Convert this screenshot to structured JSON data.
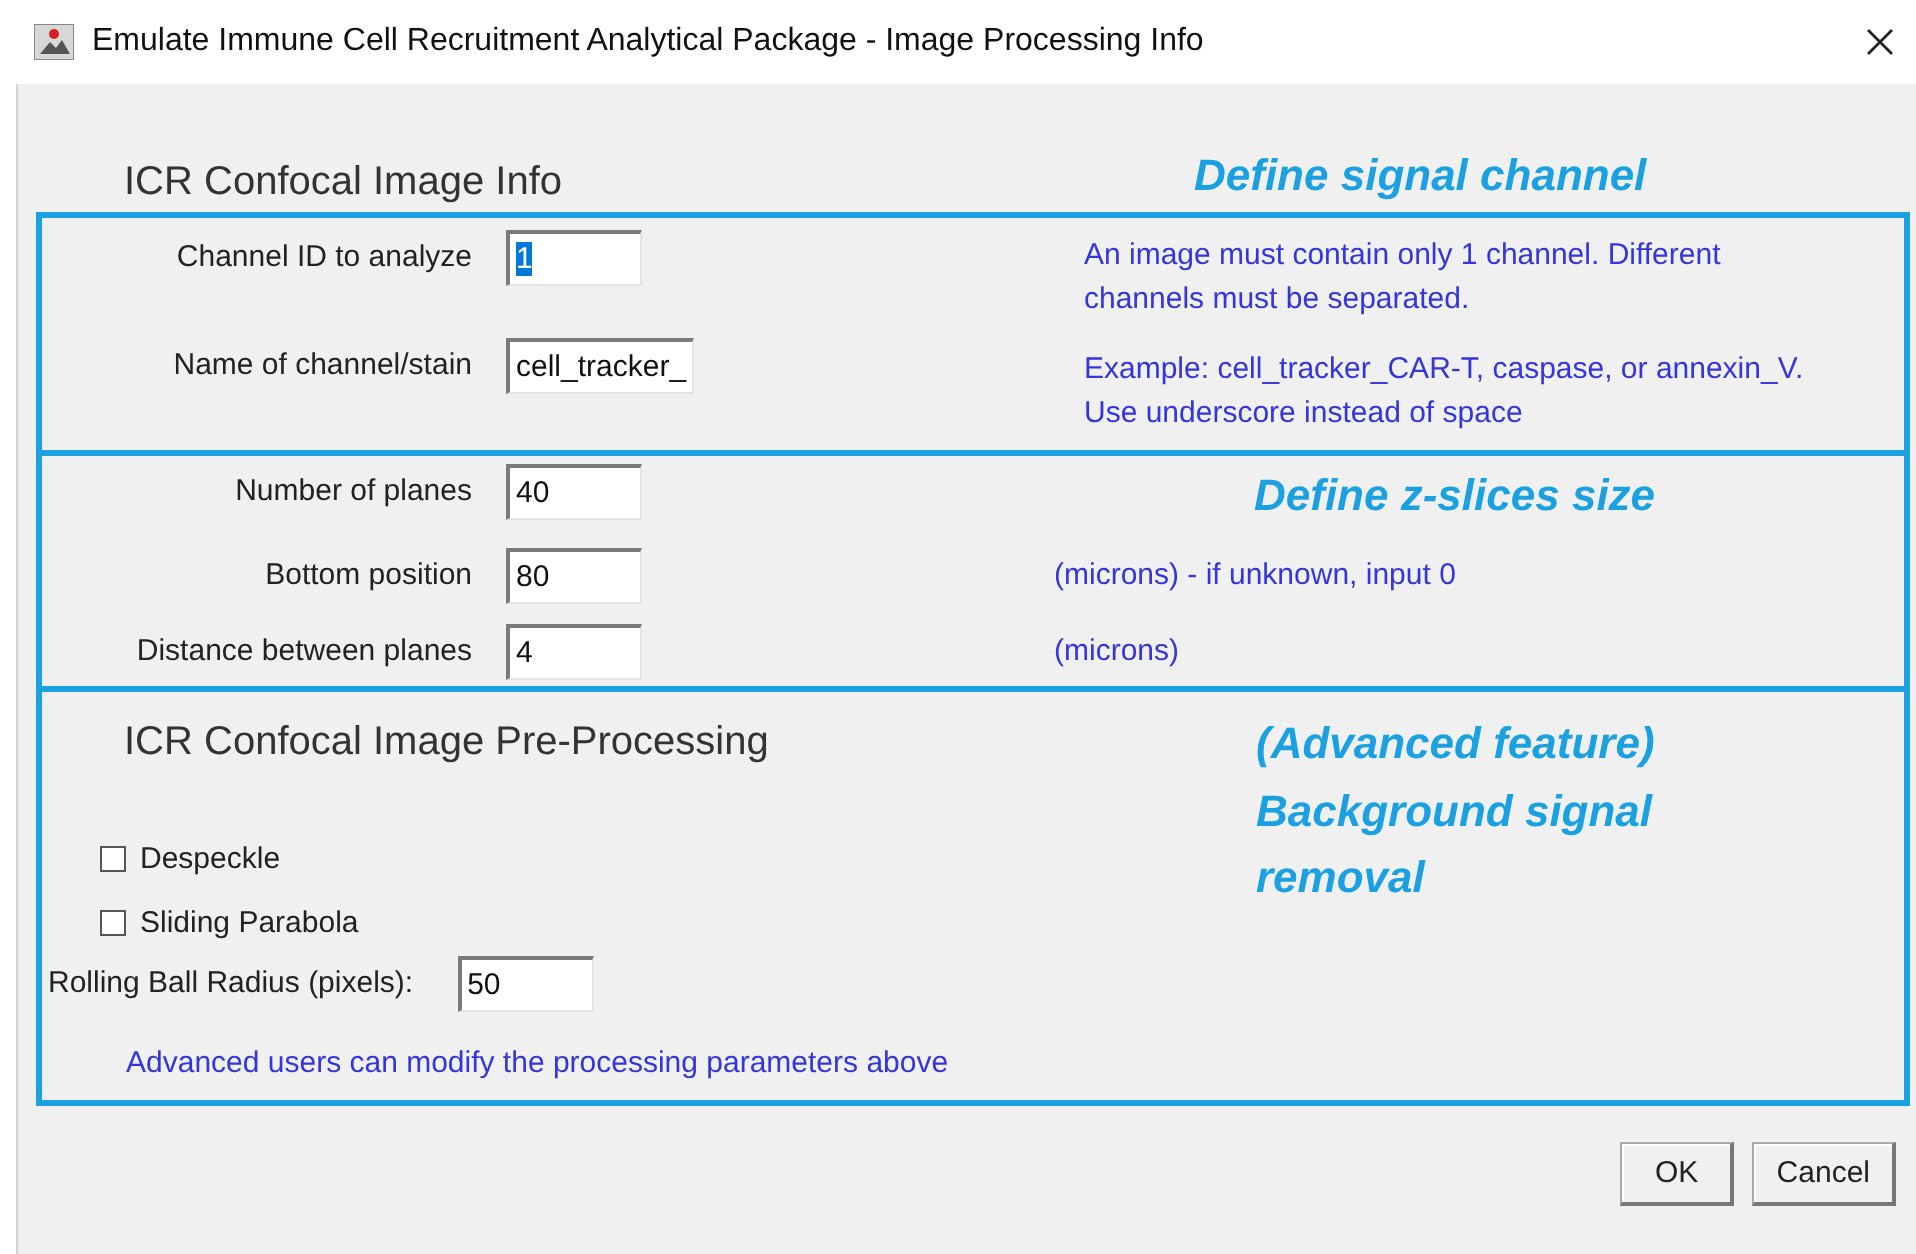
{
  "window": {
    "title": "Emulate Immune Cell Recruitment Analytical Package - Image Processing Info"
  },
  "info": {
    "heading": "ICR Confocal Image Info",
    "callout": "Define signal channel",
    "fields": [
      {
        "label": "Channel ID to analyze",
        "value": "1",
        "selected": true,
        "note": [
          "An image must contain only 1 channel. Different",
          "channels must be separated."
        ]
      },
      {
        "label": "Name of channel/stain",
        "value": "cell_tracker_",
        "selected": false,
        "note": [
          "Example: cell_tracker_CAR-T, caspase, or annexin_V.",
          "Use underscore instead of space"
        ]
      }
    ]
  },
  "z_slices": {
    "callout": "Define z-slices size",
    "fields": [
      {
        "label": "Number of planes",
        "value": "40",
        "selected": false
      },
      {
        "label": "Bottom position",
        "value": "80",
        "selected": false,
        "note": [
          "(microns) - if unknown, input 0"
        ]
      },
      {
        "label": "Distance between planes",
        "value": "4",
        "selected": false,
        "note": [
          "(microns)"
        ]
      }
    ]
  },
  "preprocessing": {
    "heading": "ICR Confocal Image Pre-Processing",
    "callout": [
      "(Advanced feature)",
      "Background signal",
      "removal"
    ],
    "options": [
      {
        "label": "Despeckle",
        "checked": false
      },
      {
        "label": "Sliding Parabola",
        "checked": false
      }
    ],
    "radius": {
      "label": "Rolling Ball Radius (pixels):",
      "value": "50",
      "selected": false
    },
    "note": "Advanced users can modify the processing parameters above"
  },
  "buttons": [
    "OK",
    "Cancel"
  ]
}
